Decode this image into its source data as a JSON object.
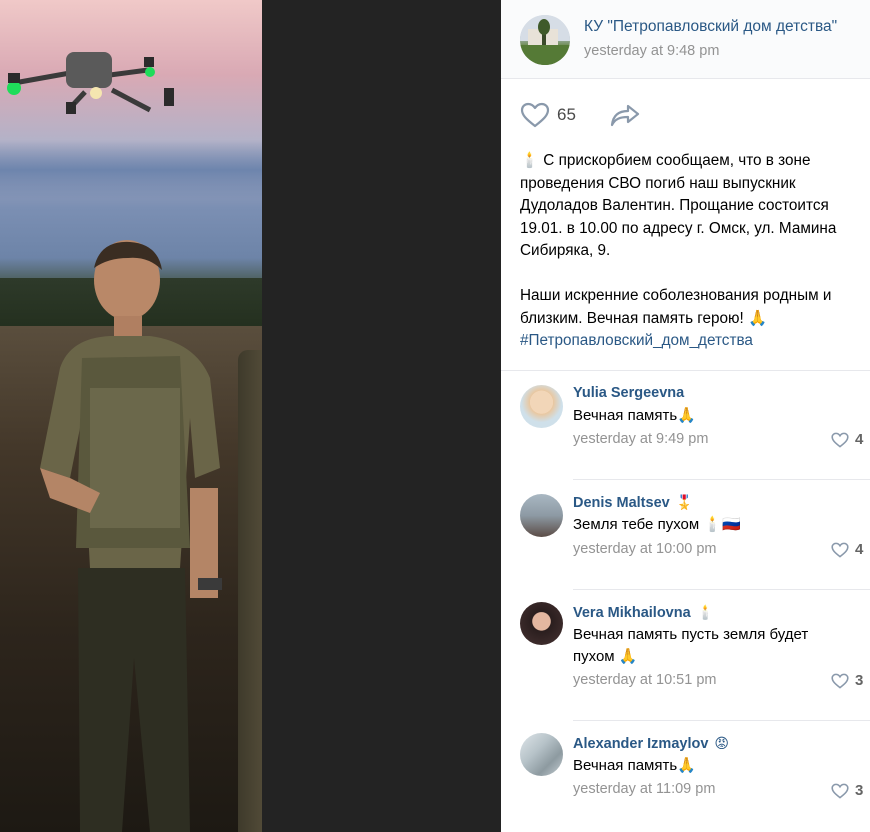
{
  "post": {
    "group_name": "КУ \"Петропавловский дом детства\"",
    "time": "yesterday at 9:48 pm",
    "likes": "65",
    "text_lines": [
      "🕯️ С прискорбием сообщаем, что в зоне",
      "проведения СВО погиб наш выпускник",
      "Дудоладов Валентин. Прощание состоится",
      "19.01. в 10.00 по адресу г. Омск, ул. Мамина",
      "Сибиряка, 9."
    ],
    "text_lines_2": [
      "Наши искренние соболезнования родным и",
      "близким. Вечная память герою! 🙏"
    ],
    "hashtag": "#Петропавловский_дом_детства"
  },
  "icons": {
    "like": "heart-outline-icon",
    "share": "share-arrow-icon",
    "comment_like": "small-heart-icon"
  },
  "colors": {
    "link": "#2a5885",
    "muted": "#939393",
    "divider": "#e7e8ec"
  },
  "comments": [
    {
      "name": "Yulia Sergeevna",
      "badge": "",
      "text": "Вечная память🙏",
      "time": "yesterday at 9:49 pm",
      "likes": "4"
    },
    {
      "name": "Denis Maltsev",
      "badge": "🎖️",
      "text": "Земля тебе пухом 🕯️🇷🇺",
      "time": "yesterday at 10:00 pm",
      "likes": "4"
    },
    {
      "name": "Vera Mikhailovna",
      "badge": "🕯️",
      "text": "Вечная память пусть земля будет пухом 🙏",
      "time": "yesterday at 10:51 pm",
      "likes": "3"
    },
    {
      "name": "Alexander Izmaylov",
      "badge": "😡",
      "text": "Вечная память🙏",
      "time": "yesterday at 11:09 pm",
      "likes": "3"
    }
  ]
}
